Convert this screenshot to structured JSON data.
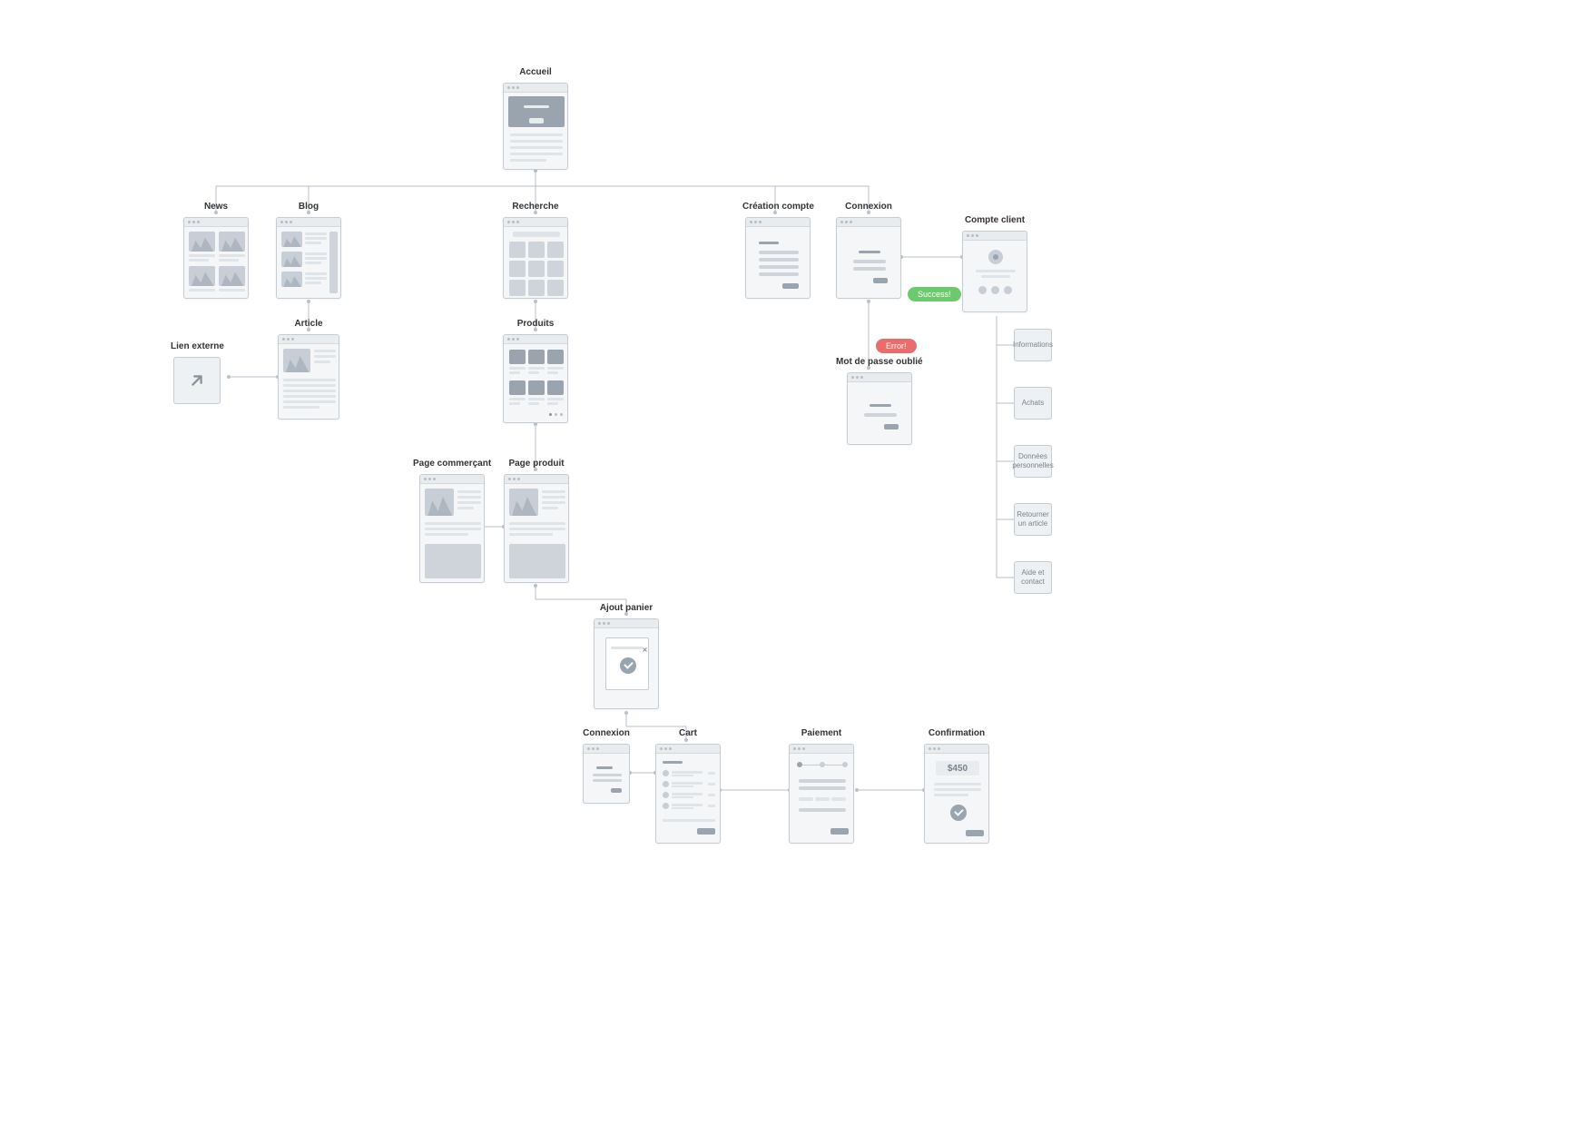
{
  "nodes": {
    "accueil": {
      "label": "Accueil"
    },
    "news": {
      "label": "News"
    },
    "blog": {
      "label": "Blog"
    },
    "recherche": {
      "label": "Recherche"
    },
    "creation": {
      "label": "Création compte"
    },
    "connexion": {
      "label": "Connexion"
    },
    "compte": {
      "label": "Compte client"
    },
    "article": {
      "label": "Article"
    },
    "lien": {
      "label": "Lien externe"
    },
    "produits": {
      "label": "Produits"
    },
    "mdp": {
      "label": "Mot de passe oublié"
    },
    "commercant": {
      "label": "Page commerçant"
    },
    "produit": {
      "label": "Page produit"
    },
    "ajout": {
      "label": "Ajout panier"
    },
    "connexion2": {
      "label": "Connexion"
    },
    "cart": {
      "label": "Cart"
    },
    "paiement": {
      "label": "Paiement"
    },
    "confirmation": {
      "label": "Confirmation"
    }
  },
  "subpages": [
    "Informations",
    "Achats",
    "Données personnelles",
    "Retourner un article",
    "Aide et contact"
  ],
  "badges": {
    "success": "Success!",
    "error": "Error!"
  },
  "confirmation_amount": "$450"
}
